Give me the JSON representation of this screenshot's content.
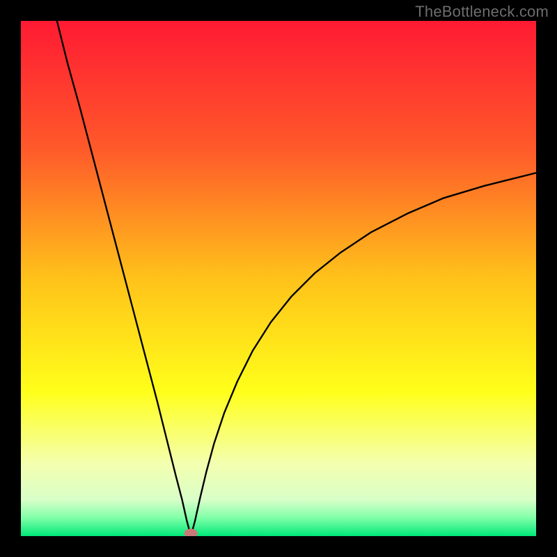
{
  "watermark": "TheBottleneck.com",
  "chart_data": {
    "type": "line",
    "title": "",
    "xlabel": "",
    "ylabel": "",
    "xlim": [
      0,
      100
    ],
    "ylim": [
      0,
      100
    ],
    "grid": false,
    "legend": false,
    "gradient_stops": [
      {
        "offset": 0.0,
        "color": "#ff1a33"
      },
      {
        "offset": 0.25,
        "color": "#ff5a2a"
      },
      {
        "offset": 0.5,
        "color": "#ffc21a"
      },
      {
        "offset": 0.72,
        "color": "#ffff1a"
      },
      {
        "offset": 0.86,
        "color": "#f4ffb0"
      },
      {
        "offset": 0.93,
        "color": "#d8ffc8"
      },
      {
        "offset": 0.965,
        "color": "#7fffa8"
      },
      {
        "offset": 1.0,
        "color": "#00e878"
      }
    ],
    "marker": {
      "x": 33,
      "y": 0,
      "color": "#c97a78",
      "rx": 1.3,
      "ry": 0.9
    },
    "series": [
      {
        "name": "left-branch",
        "x": [
          7.0,
          9.0,
          11.5,
          14.0,
          16.5,
          19.0,
          21.5,
          24.0,
          26.5,
          28.5,
          30.0,
          31.3,
          32.2,
          33.0
        ],
        "y": [
          100.0,
          92.0,
          83.0,
          73.5,
          64.0,
          54.5,
          45.0,
          35.5,
          26.0,
          18.0,
          12.0,
          7.0,
          3.0,
          0.0
        ]
      },
      {
        "name": "right-branch",
        "x": [
          33.0,
          33.8,
          34.8,
          36.0,
          37.5,
          39.5,
          42.0,
          45.0,
          48.5,
          52.5,
          57.0,
          62.0,
          68.0,
          75.0,
          82.0,
          90.0,
          100.0
        ],
        "y": [
          0.0,
          3.0,
          7.5,
          12.5,
          18.0,
          24.0,
          30.0,
          36.0,
          41.5,
          46.5,
          51.0,
          55.0,
          59.0,
          62.6,
          65.6,
          68.0,
          70.5
        ]
      }
    ]
  }
}
